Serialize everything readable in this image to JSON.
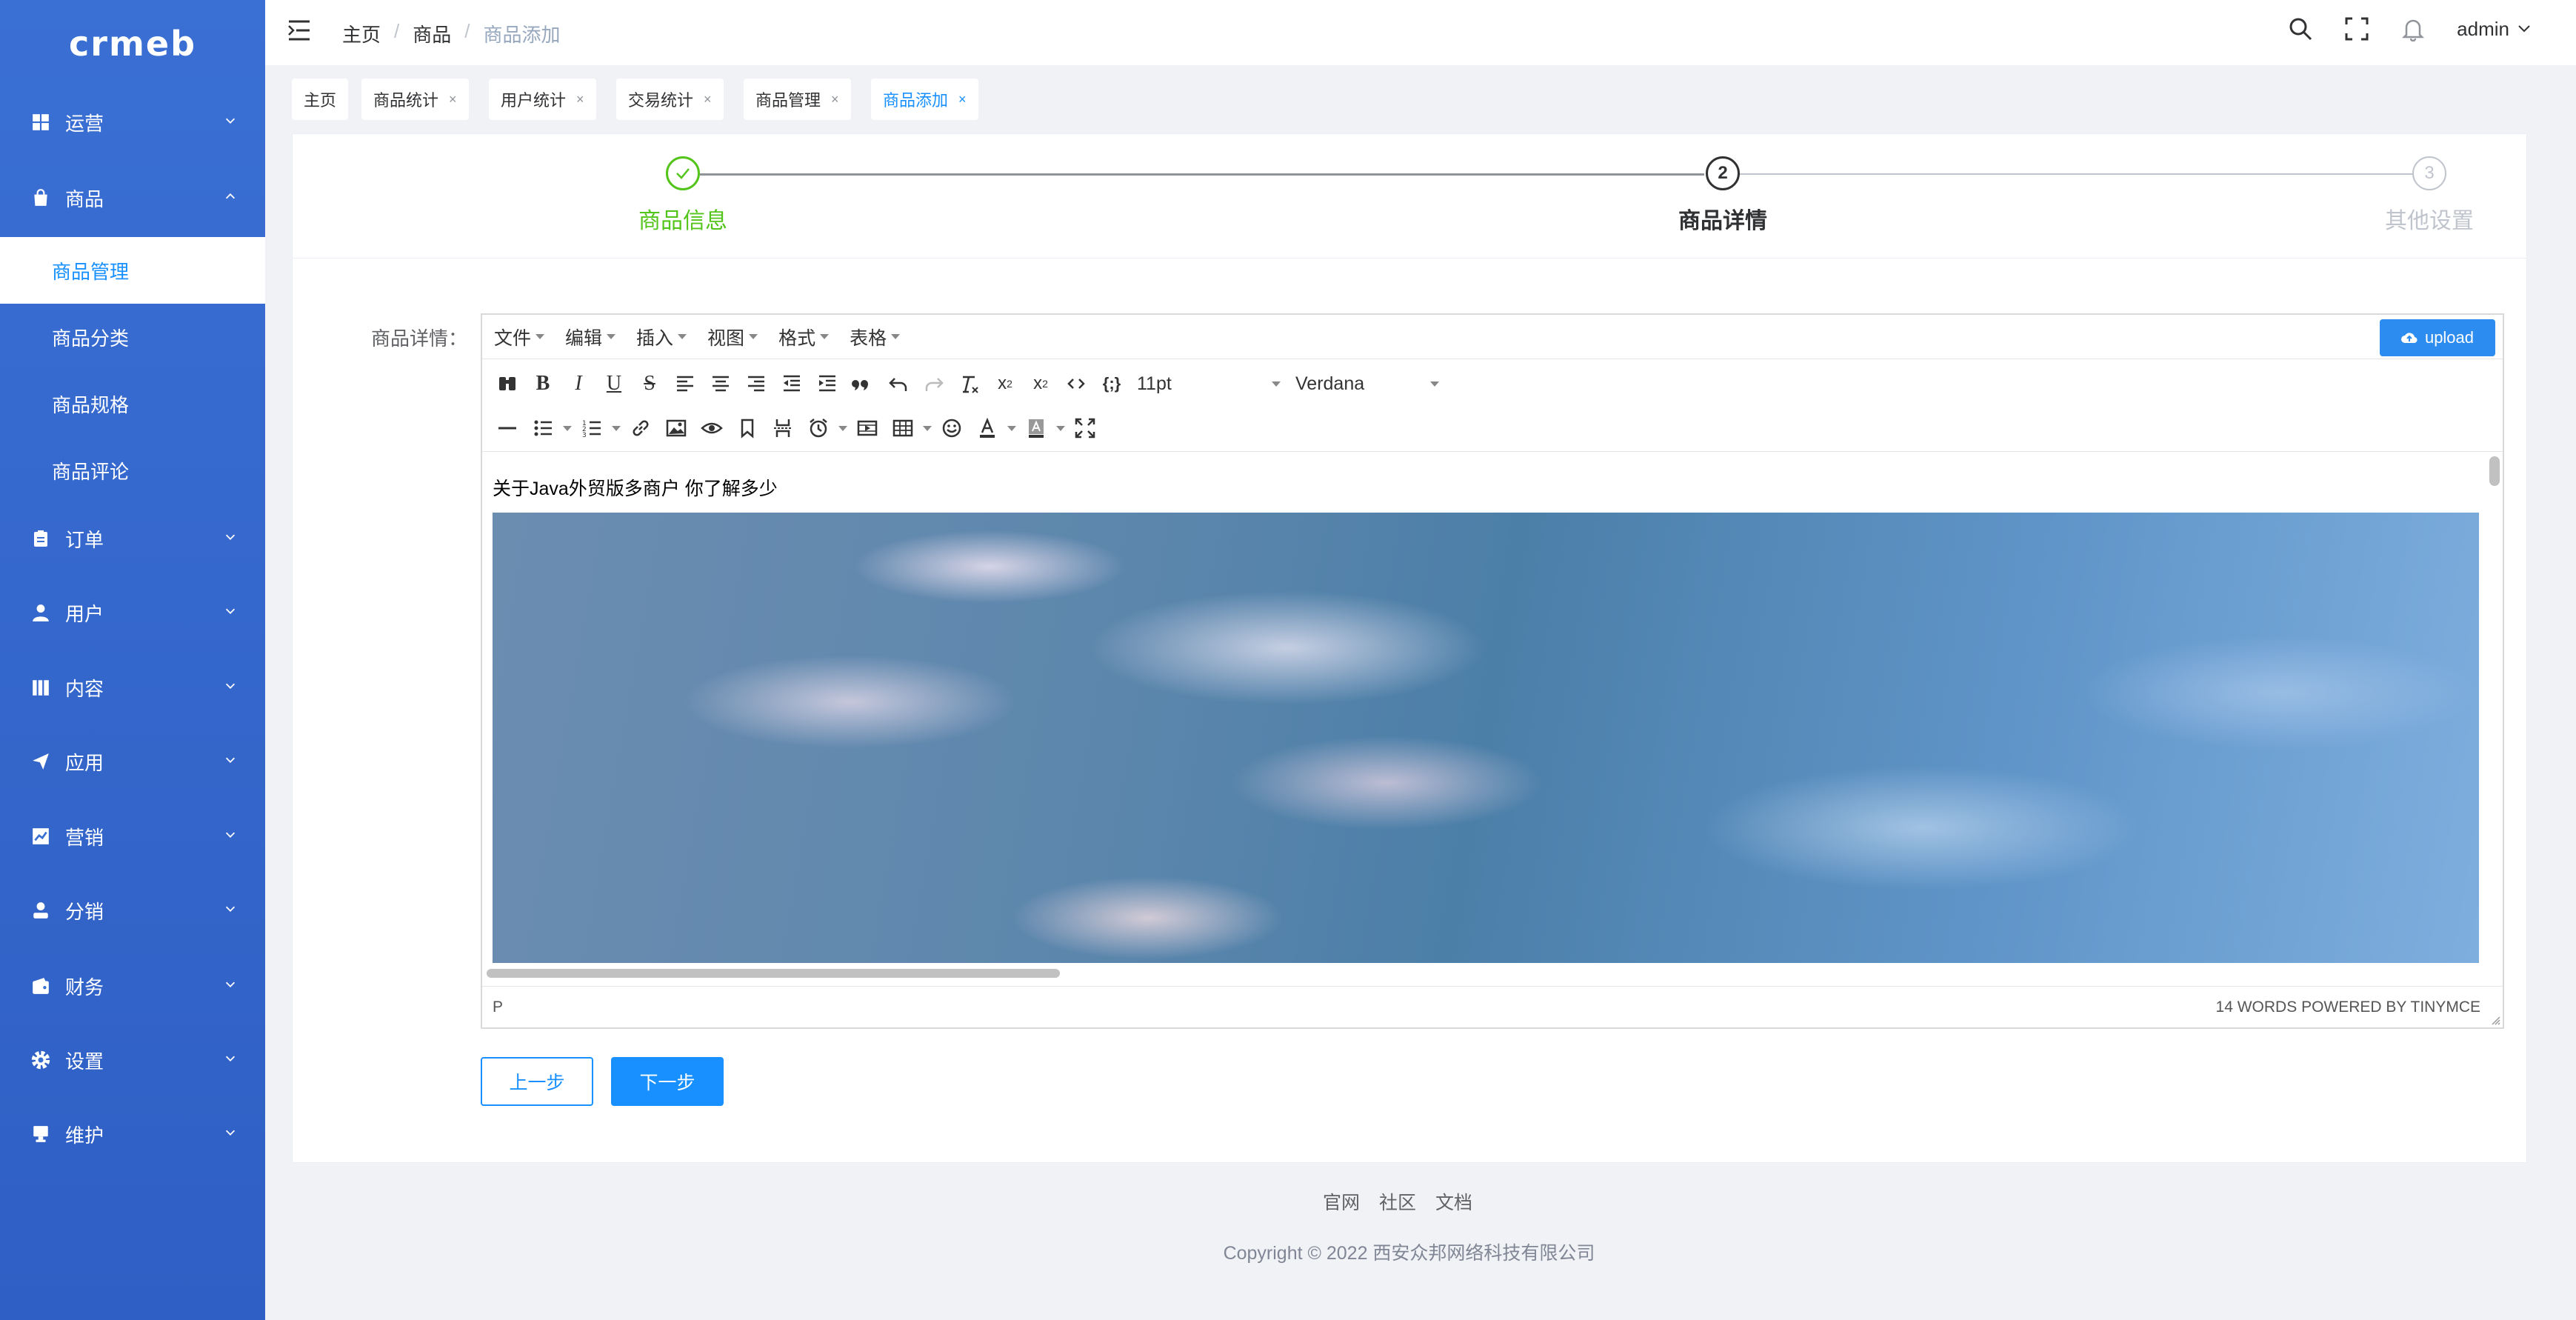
{
  "sidebar": {
    "logo": "crmeb",
    "menu": [
      {
        "label": "运营",
        "icon": "grid-icon"
      },
      {
        "label": "商品",
        "icon": "bag-icon"
      },
      {
        "label": "订单",
        "icon": "clipboard-icon"
      },
      {
        "label": "用户",
        "icon": "user-icon"
      },
      {
        "label": "内容",
        "icon": "book-icon"
      },
      {
        "label": "应用",
        "icon": "send-icon"
      },
      {
        "label": "营销",
        "icon": "chart-icon"
      },
      {
        "label": "分销",
        "icon": "person-icon"
      },
      {
        "label": "财务",
        "icon": "wallet-icon"
      },
      {
        "label": "设置",
        "icon": "gear-icon"
      },
      {
        "label": "维护",
        "icon": "monitor-icon"
      }
    ],
    "submenu": [
      {
        "label": "商品管理",
        "active": true
      },
      {
        "label": "商品分类"
      },
      {
        "label": "商品规格"
      },
      {
        "label": "商品评论"
      }
    ]
  },
  "header": {
    "breadcrumb": [
      "主页",
      "商品",
      "商品添加"
    ],
    "user": "admin"
  },
  "tags": [
    {
      "label": "主页"
    },
    {
      "label": "商品统计",
      "close": "×"
    },
    {
      "label": "用户统计",
      "close": "×"
    },
    {
      "label": "交易统计",
      "close": "×"
    },
    {
      "label": "商品管理",
      "close": "×"
    },
    {
      "label": "商品添加",
      "close": "×",
      "active": true
    }
  ],
  "steps": [
    {
      "number": "1",
      "title": "商品信息",
      "status": "finished"
    },
    {
      "number": "2",
      "title": "商品详情",
      "status": "active"
    },
    {
      "number": "3",
      "title": "其他设置",
      "status": "waiting"
    }
  ],
  "form": {
    "label": "商品详情："
  },
  "editor": {
    "menus": [
      "文件",
      "编辑",
      "插入",
      "视图",
      "格式",
      "表格"
    ],
    "upload_label": "upload",
    "font_size": "11pt",
    "font_family": "Verdana",
    "content_text": "关于Java外贸版多商户 你了解多少",
    "status_left": "P",
    "status_right": "14 WORDS POWERED BY TINYMCE"
  },
  "buttons": {
    "prev": "上一步",
    "next": "下一步"
  },
  "footer": {
    "links": [
      "官网",
      "社区",
      "文档"
    ],
    "copyright": "Copyright © 2022 西安众邦网络科技有限公司"
  },
  "colors": {
    "sidebar": "#3a6fd3",
    "primary": "#1890ff",
    "success": "#52c41a"
  }
}
